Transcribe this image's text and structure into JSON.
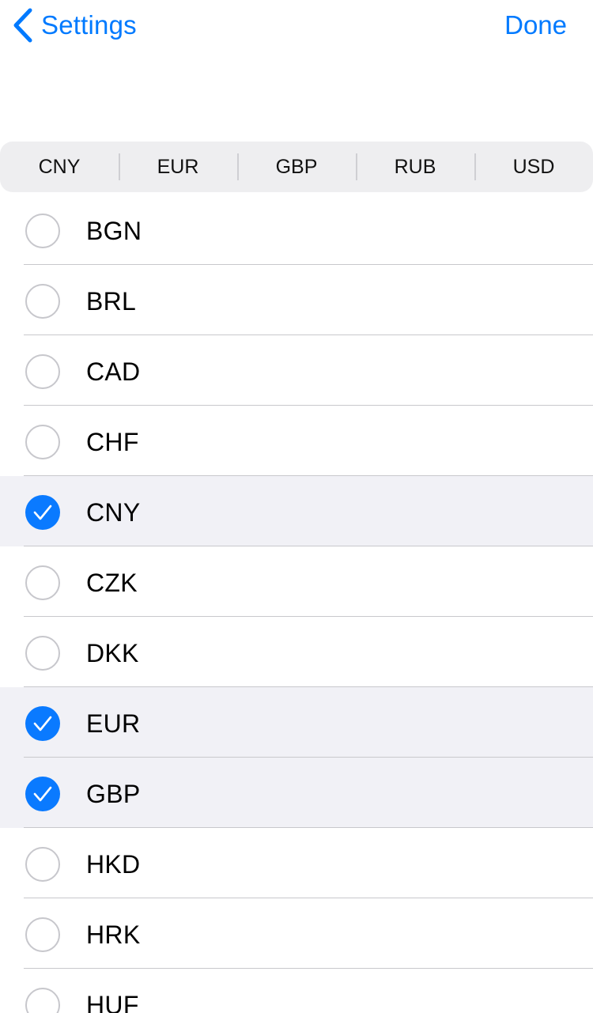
{
  "navbar": {
    "back_label": "Settings",
    "done_label": "Done",
    "accent_color": "#007aff"
  },
  "segments": [
    "CNY",
    "EUR",
    "GBP",
    "RUB",
    "USD"
  ],
  "currencies": [
    {
      "code": "BGN",
      "selected": false
    },
    {
      "code": "BRL",
      "selected": false
    },
    {
      "code": "CAD",
      "selected": false
    },
    {
      "code": "CHF",
      "selected": false
    },
    {
      "code": "CNY",
      "selected": true
    },
    {
      "code": "CZK",
      "selected": false
    },
    {
      "code": "DKK",
      "selected": false
    },
    {
      "code": "EUR",
      "selected": true
    },
    {
      "code": "GBP",
      "selected": true
    },
    {
      "code": "HKD",
      "selected": false
    },
    {
      "code": "HRK",
      "selected": false
    },
    {
      "code": "HUF",
      "selected": false
    }
  ],
  "icons": {
    "back": "chevron-left-icon",
    "check": "checkmark-icon",
    "radio": "radio-circle-icon"
  }
}
